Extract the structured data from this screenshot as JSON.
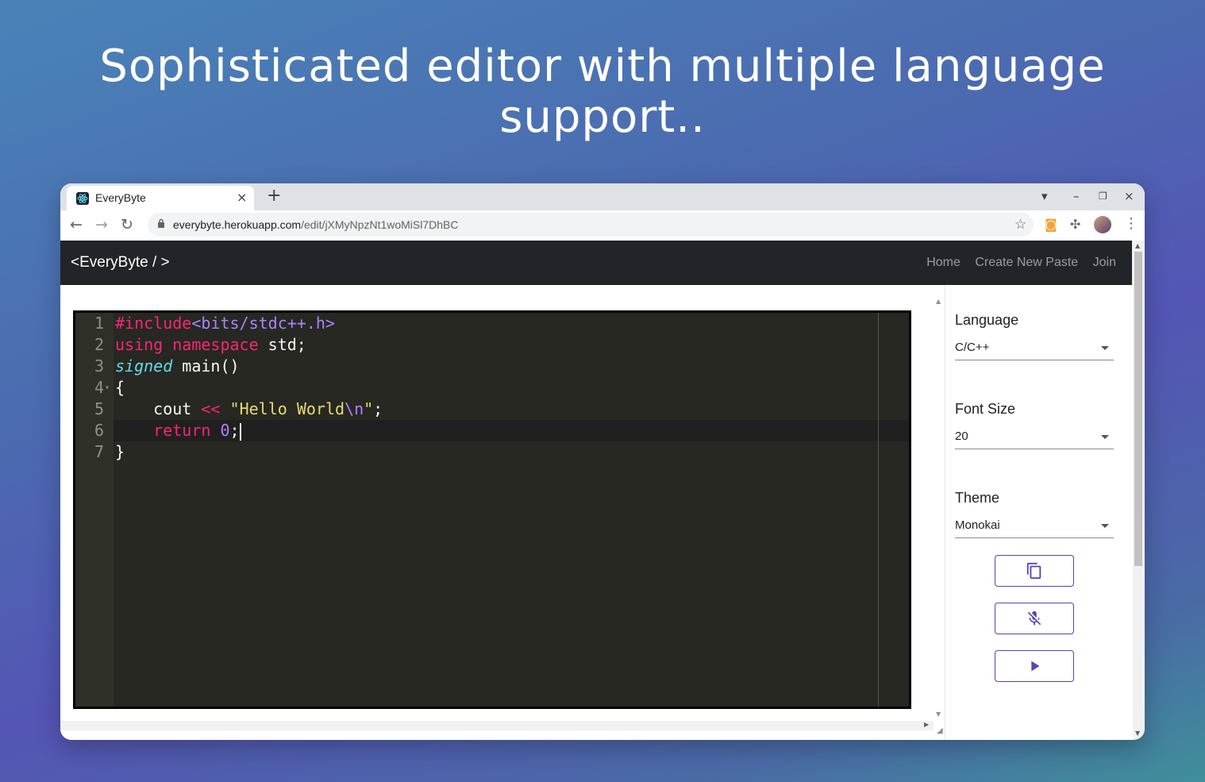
{
  "headline": {
    "line1": "Sophisticated  editor with multiple language",
    "line2": "support.."
  },
  "browser": {
    "tab": {
      "title": "EveryByte",
      "close": "×"
    },
    "new_tab": "+",
    "window_controls": {
      "profile": "▾",
      "minimize": "–",
      "restore": "❐",
      "close": "×"
    },
    "nav": {
      "back": "←",
      "forward": "→",
      "reload": "↻"
    },
    "url": {
      "host": "everybyte.herokuapp.com",
      "path": "/edit/jXMyNpzNt1woMiSl7DhBC"
    }
  },
  "app": {
    "brand": "<EveryByte / >",
    "nav_links": {
      "home": "Home",
      "create": "Create New Paste",
      "join": "Join"
    }
  },
  "editor": {
    "theme_colors": {
      "background": "#272822",
      "keyword": "#f92672",
      "string": "#e6db74",
      "type": "#66d9ef",
      "number": "#ae81ff"
    },
    "lines": [
      {
        "n": "1",
        "include_kw": "#include",
        "include_file": "<bits/stdc++.h>"
      },
      {
        "n": "2",
        "kw1": "using",
        "kw2": "namespace",
        "rest": " std;"
      },
      {
        "n": "3",
        "type": "signed",
        "rest": " main()"
      },
      {
        "n": "4",
        "text": "{"
      },
      {
        "n": "5",
        "indent": "    ",
        "ident": "cout",
        "op": "<<",
        "str_open": "\"Hello World",
        "esc": "\\n",
        "str_close": "\"",
        "end": ";"
      },
      {
        "n": "6",
        "indent": "    ",
        "kw": "return",
        "num": "0",
        "end": ";"
      },
      {
        "n": "7",
        "text": "}"
      }
    ]
  },
  "sidebar": {
    "language": {
      "label": "Language",
      "value": "C/C++"
    },
    "font_size": {
      "label": "Font Size",
      "value": "20"
    },
    "theme": {
      "label": "Theme",
      "value": "Monokai"
    },
    "buttons": [
      {
        "icon": "copy-icon"
      },
      {
        "icon": "mic-off-icon"
      },
      {
        "icon": "play-icon"
      }
    ],
    "accent_color": "#5a41b5"
  }
}
